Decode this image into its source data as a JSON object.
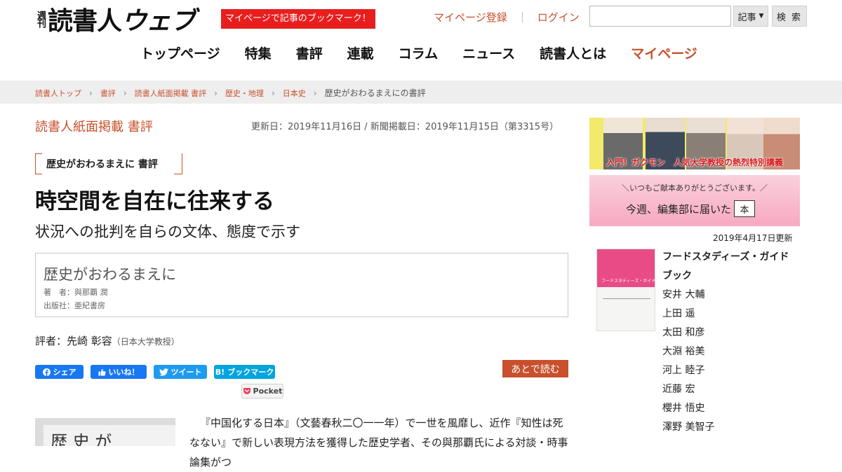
{
  "header": {
    "logo": {
      "weekly": "週刊",
      "name_main": "読書人",
      "name_sub": "ウェブ"
    },
    "promo_label": "マイページで記事のブックマーク！",
    "register_link": "マイページ登録",
    "separator": "｜",
    "login_link": "ログイン",
    "search": {
      "placeholder": "",
      "select_value": "記事",
      "button_label": "検 索"
    }
  },
  "nav": {
    "items": [
      "トップページ",
      "特集",
      "書評",
      "連載",
      "コラム",
      "ニュース",
      "読書人とは"
    ],
    "mypage": "マイページ"
  },
  "breadcrumb": {
    "items": [
      "読書人トップ",
      "書評",
      "読書人紙面掲載 書評",
      "歴史・地理",
      "日本史"
    ],
    "current": "歴史がおわるまえにの書評"
  },
  "article": {
    "category": "読書人紙面掲載 書評",
    "dates": "更新日：2019年11月16日 / 新聞掲載日：2019年11月15日（第3315号）",
    "tag": "歴史がおわるまえに 書評",
    "headline": "時空間を自在に往来する",
    "subheadline": "状況への批判を自らの文体、態度で示す",
    "book": {
      "title": "歴史がおわるまえに",
      "author": "著　者：與那覇 潤",
      "publisher": "出版社：亜紀書房"
    },
    "reviewer_label": "評者：",
    "reviewer_name": "先崎 彰容",
    "reviewer_affiliation": "（日本大学教授）",
    "share": {
      "facebook": "シェア",
      "like": "いいね！",
      "twitter": "ツイート",
      "hatena": "ブックマーク",
      "hatena_mark": "B!",
      "pocket": "Pocket"
    },
    "read_later": "あとで読む",
    "thumb_text": "歴 史 が",
    "body": "『中国化する日本』（文藝春秋二〇一一年）で一世を風靡し、近作『知性は死なない』で新しい表現方法を獲得した歴史学者、その與那覇氏による対談・時事論集がつ"
  },
  "sidebar": {
    "banner1_caption": "入門！ガクモン　人気大学教授の熱烈特別講義",
    "banner2_small": "＼いつもご献本ありがとうございます。／",
    "banner2_big": "今週、編集部に届いた",
    "banner2_book": "本",
    "updated": "2019年4月17日更新",
    "cover_title": "フードスタディーズ・ガイドブック",
    "book_title": "フードスタディーズ・ガイドブック",
    "authors": [
      "安井 大輔",
      "上田 遥",
      "太田 和彦",
      "大淵 裕美",
      "河上 睦子",
      "近藤 宏",
      "櫻井 悟史",
      "澤野 美智子"
    ]
  },
  "colors": {
    "accent": "#c8502c",
    "promo": "#e81e1e",
    "facebook": "#1877f2",
    "twitter": "#1d9bf0",
    "hatena": "#00a4de"
  }
}
